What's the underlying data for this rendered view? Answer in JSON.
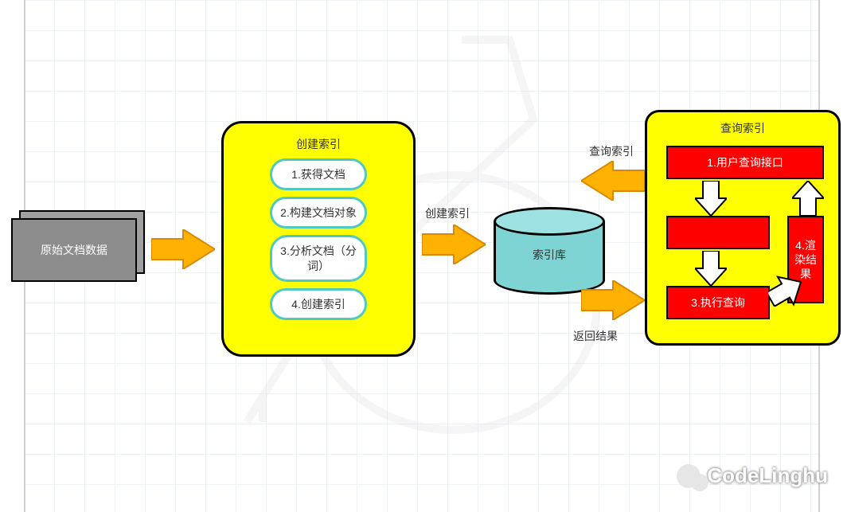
{
  "source": {
    "label": "原始文档数据"
  },
  "create_index": {
    "title": "创建索引",
    "steps": {
      "s1": "1.获得文档",
      "s2": "2.构建文档对象",
      "s3": "3.分析文档（分词）",
      "s4": "4.创建索引"
    }
  },
  "arrow_labels": {
    "create": "创建索引",
    "query": "查询索引",
    "result": "返回结果"
  },
  "index_store": {
    "label": "索引库"
  },
  "query_index": {
    "title": "查询索引",
    "steps": {
      "s1": "1.用户查询接口",
      "s2": "",
      "s3": "3.执行查询",
      "s4": "4.渲染结果"
    }
  },
  "watermark": "CodeLinghu"
}
